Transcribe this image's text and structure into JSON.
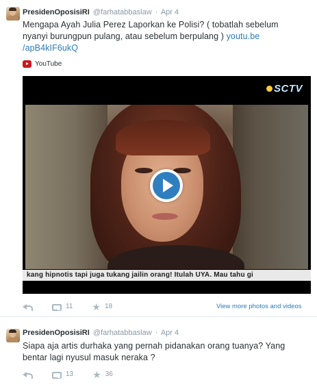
{
  "tweets": [
    {
      "fullname": "PresidenOposisiRI",
      "screenname": "@farhatabbaslaw",
      "dot": "·",
      "time": "Apr 4",
      "text_plain": "Mengapa Ayah Julia Perez Laporkan ke Polisi? ( tobatlah sebelum nyanyi burungpun pulang, atau sebelum berpulang ) ",
      "link_part1": "youtu.be",
      "link_part2": "/apB4kIF6ukQ",
      "source": "YouTube",
      "video": {
        "watermark": "SCTV",
        "ticker": "kang hipnotis tapi juga tukang jailin orang! Itulah UYA. Mau tahu gi"
      },
      "reply_count": "",
      "retweet_count": "11",
      "favorite_count": "18",
      "view_more": "View more photos and videos"
    },
    {
      "fullname": "PresidenOposisiRI",
      "screenname": "@farhatabbaslaw",
      "dot": "·",
      "time": "Apr 4",
      "text_plain": "Siapa aja artis durhaka yang pernah pidanakan orang tuanya? Yang bentar lagi nyusul masuk neraka ?",
      "retweet_count": "13",
      "favorite_count": "36"
    }
  ],
  "icons": {
    "reply": "reply-icon",
    "retweet": "retweet-icon",
    "favorite": "star-icon",
    "youtube": "youtube-icon",
    "play": "play-icon"
  },
  "colors": {
    "link": "#2b7bb9",
    "text": "#292f33",
    "muted": "#8899a6",
    "play": "#2f7ec0"
  }
}
